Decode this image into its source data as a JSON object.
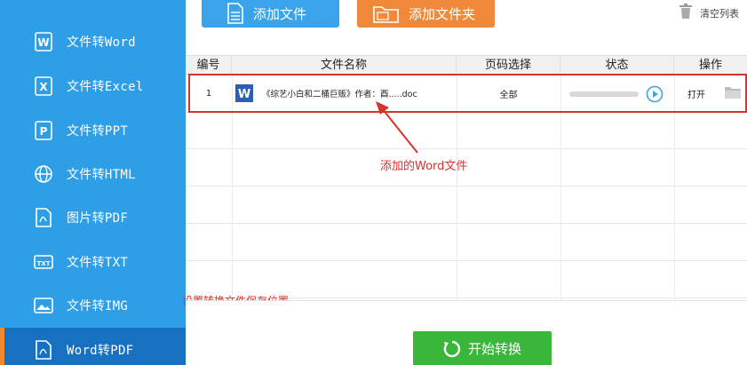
{
  "sidebar": {
    "items": [
      {
        "label": "文件转Word",
        "icon": "word-icon"
      },
      {
        "label": "文件转Excel",
        "icon": "excel-icon"
      },
      {
        "label": "文件转PPT",
        "icon": "ppt-icon"
      },
      {
        "label": "文件转HTML",
        "icon": "globe-icon"
      },
      {
        "label": "图片转PDF",
        "icon": "pdf-image-icon"
      },
      {
        "label": "文件转TXT",
        "icon": "txt-icon"
      },
      {
        "label": "文件转IMG",
        "icon": "image-icon"
      },
      {
        "label": "Word转PDF",
        "icon": "pdf-icon",
        "active": true
      }
    ]
  },
  "toolbar": {
    "add_file_label": "添加文件",
    "add_folder_label": "添加文件夹",
    "clear_list_label": "清空列表"
  },
  "table": {
    "columns": [
      "编号",
      "文件名称",
      "页码选择",
      "状态",
      "操作"
    ],
    "rows": [
      {
        "index": "1",
        "file_name": "《综艺小白和二桶巨贩》作者：酉.....doc",
        "pages": "全部",
        "progress": 0,
        "action_open": "打开"
      }
    ]
  },
  "annotations": {
    "word_file": "添加的Word文件",
    "save_location": "设置转换文件保存位置"
  },
  "start_button_label": "开始转换",
  "colors": {
    "sidebar": "#2e9ee6",
    "sidebar_active": "#1771c0",
    "accent_orange": "#f08a3a",
    "start_green": "#3ab63a",
    "annotation_red": "#d9312b"
  }
}
